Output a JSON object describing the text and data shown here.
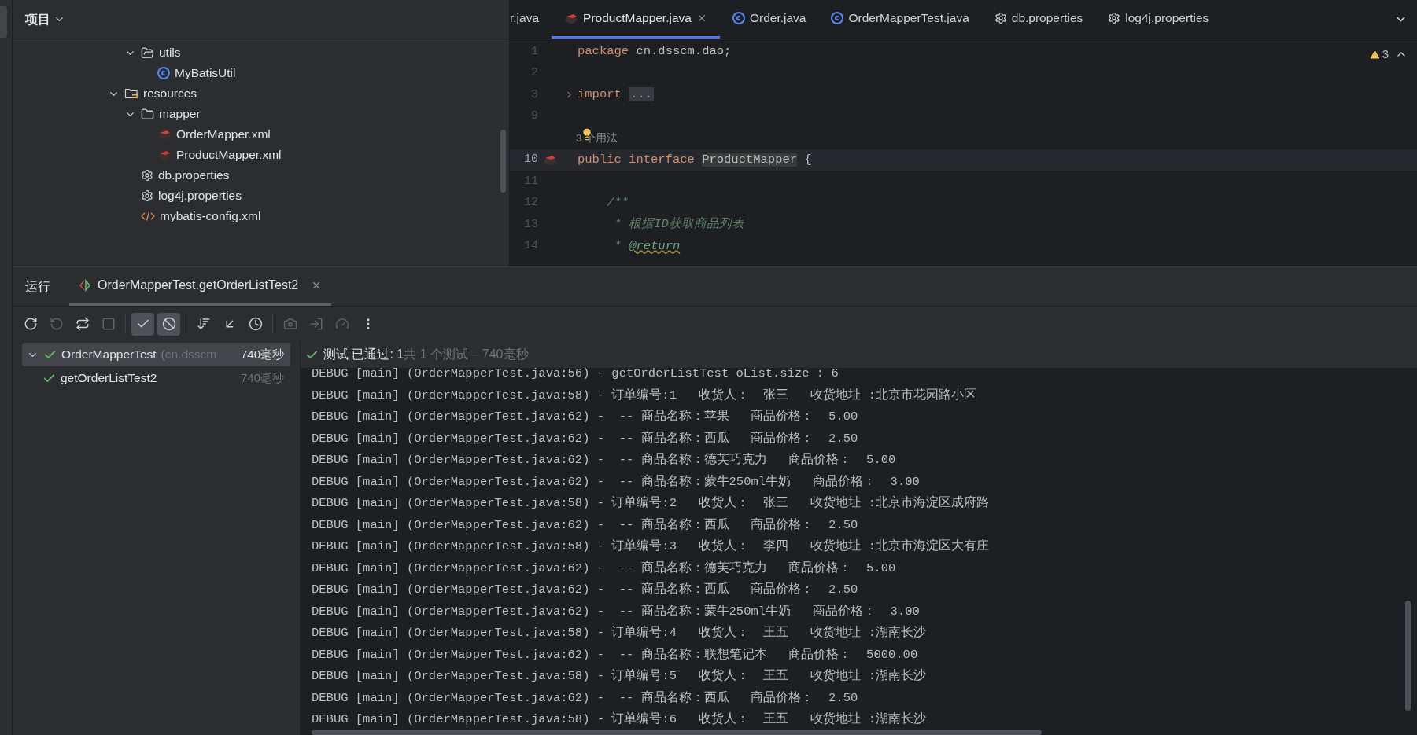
{
  "project": {
    "title": "项目",
    "tree": [
      {
        "label": "utils",
        "kind": "package",
        "expanded": true,
        "children": [
          {
            "label": "MyBatisUtil",
            "kind": "class"
          }
        ]
      },
      {
        "label": "resources",
        "kind": "resources",
        "expanded": true,
        "children": [
          {
            "label": "mapper",
            "kind": "folder",
            "expanded": true,
            "children": [
              {
                "label": "OrderMapper.xml",
                "kind": "mybatis"
              },
              {
                "label": "ProductMapper.xml",
                "kind": "mybatis"
              }
            ]
          },
          {
            "label": "db.properties",
            "kind": "gear"
          },
          {
            "label": "log4j.properties",
            "kind": "gear"
          },
          {
            "label": "mybatis-config.xml",
            "kind": "xml"
          }
        ]
      }
    ]
  },
  "editor": {
    "tabs": [
      {
        "label": "r.java",
        "kind": "plain",
        "selected": false,
        "closable": false
      },
      {
        "label": "ProductMapper.java",
        "kind": "mybatis",
        "selected": true,
        "closable": true
      },
      {
        "label": "Order.java",
        "kind": "class",
        "selected": false,
        "closable": false
      },
      {
        "label": "OrderMapperTest.java",
        "kind": "class",
        "selected": false,
        "closable": false
      },
      {
        "label": "db.properties",
        "kind": "gear",
        "selected": false,
        "closable": false
      },
      {
        "label": "log4j.properties",
        "kind": "gear",
        "selected": false,
        "closable": false
      }
    ],
    "warnings": "3",
    "lines": [
      {
        "kind": "code",
        "number": "1",
        "current": false,
        "tokens": [
          {
            "kind": "keyword",
            "text": "package"
          },
          {
            "kind": "plain",
            "text": " cn.dsscm.dao;"
          }
        ]
      },
      {
        "kind": "code",
        "number": "2",
        "current": false
      },
      {
        "kind": "code",
        "number": "3",
        "current": false,
        "fold": true,
        "tokens": [
          {
            "kind": "keyword",
            "text": "import "
          },
          {
            "kind": "folded",
            "text": "..."
          }
        ]
      },
      {
        "kind": "code",
        "number": "9",
        "current": false
      },
      {
        "kind": "hint",
        "text": "3 个用法"
      },
      {
        "kind": "code",
        "number": "10",
        "current": true,
        "mapper_marker": true,
        "tokens": [
          {
            "kind": "keyword",
            "text": "public"
          },
          {
            "kind": "keyword",
            "text": " interface "
          },
          {
            "kind": "highlight",
            "text": "ProductMapper"
          },
          {
            "kind": "plain",
            "text": " {"
          }
        ]
      },
      {
        "kind": "code",
        "number": "11",
        "current": false
      },
      {
        "kind": "code",
        "number": "12",
        "current": false,
        "tokens": [
          {
            "kind": "doc",
            "text": "    /**"
          }
        ]
      },
      {
        "kind": "code",
        "number": "13",
        "current": false,
        "tokens": [
          {
            "kind": "doc",
            "text": "     * 根据ID获取商品列表"
          }
        ]
      },
      {
        "kind": "code",
        "number": "14",
        "current": false,
        "tokens": [
          {
            "kind": "doc",
            "text": "     * "
          },
          {
            "kind": "doctag",
            "text": "@return"
          }
        ]
      }
    ]
  },
  "run": {
    "title": "运行",
    "tabs": [
      {
        "label": "OrderMapperTest.getOrderListTest2",
        "selected": true
      }
    ],
    "toolbar": [
      {
        "kind": "rerun",
        "on": false,
        "disabled": false
      },
      {
        "kind": "rerun-failed",
        "on": false,
        "disabled": true
      },
      {
        "kind": "toggle-auto",
        "on": false,
        "disabled": false
      },
      {
        "kind": "stop",
        "on": false,
        "disabled": true
      },
      {
        "kind": "sep"
      },
      {
        "kind": "show-passed",
        "on": true,
        "disabled": false
      },
      {
        "kind": "show-ignored",
        "on": true,
        "disabled": false
      },
      {
        "kind": "sep"
      },
      {
        "kind": "sort",
        "on": false,
        "disabled": false
      },
      {
        "kind": "collapse",
        "on": false,
        "disabled": false
      },
      {
        "kind": "history",
        "on": false,
        "disabled": false
      },
      {
        "kind": "sep"
      },
      {
        "kind": "camera",
        "on": false,
        "disabled": true
      },
      {
        "kind": "import",
        "on": false,
        "disabled": true
      },
      {
        "kind": "gauge",
        "on": false,
        "disabled": true
      },
      {
        "kind": "more",
        "on": false,
        "disabled": false
      }
    ],
    "tests": [
      {
        "label": "OrderMapperTest",
        "detail": "(cn.dsscm",
        "time": "740毫秒",
        "selected": true,
        "expanded": true,
        "children": [
          {
            "label": "getOrderListTest2",
            "time": "740毫秒",
            "selected": false
          }
        ]
      }
    ],
    "status": {
      "passed": "测试 已通过: 1",
      "summary": "共 1 个测试 – 740毫秒"
    },
    "console": [
      "DEBUG [main] (OrderMapperTest.java:56) - getOrderListTest oList.size : 6",
      "DEBUG [main] (OrderMapperTest.java:58) - 订单编号:1   收货人：  张三   收货地址 :北京市花园路小区",
      "DEBUG [main] (OrderMapperTest.java:62) -  -- 商品名称：苹果   商品价格：  5.00",
      "DEBUG [main] (OrderMapperTest.java:62) -  -- 商品名称：西瓜   商品价格：  2.50",
      "DEBUG [main] (OrderMapperTest.java:62) -  -- 商品名称：德芙巧克力   商品价格：  5.00",
      "DEBUG [main] (OrderMapperTest.java:62) -  -- 商品名称：蒙牛250ml牛奶   商品价格：  3.00",
      "DEBUG [main] (OrderMapperTest.java:58) - 订单编号:2   收货人：  张三   收货地址 :北京市海淀区成府路",
      "DEBUG [main] (OrderMapperTest.java:62) -  -- 商品名称：西瓜   商品价格：  2.50",
      "DEBUG [main] (OrderMapperTest.java:58) - 订单编号:3   收货人：  李四   收货地址 :北京市海淀区大有庄",
      "DEBUG [main] (OrderMapperTest.java:62) -  -- 商品名称：德芙巧克力   商品价格：  5.00",
      "DEBUG [main] (OrderMapperTest.java:62) -  -- 商品名称：西瓜   商品价格：  2.50",
      "DEBUG [main] (OrderMapperTest.java:62) -  -- 商品名称：蒙牛250ml牛奶   商品价格：  3.00",
      "DEBUG [main] (OrderMapperTest.java:58) - 订单编号:4   收货人：  王五   收货地址 :湖南长沙",
      "DEBUG [main] (OrderMapperTest.java:62) -  -- 商品名称：联想笔记本   商品价格：  5000.00",
      "DEBUG [main] (OrderMapperTest.java:58) - 订单编号:5   收货人：  王五   收货地址 :湖南长沙",
      "DEBUG [main] (OrderMapperTest.java:62) -  -- 商品名称：西瓜   商品价格：  2.50",
      "DEBUG [main] (OrderMapperTest.java:58) - 订单编号:6   收货人：  王五   收货地址 :湖南长沙"
    ]
  }
}
